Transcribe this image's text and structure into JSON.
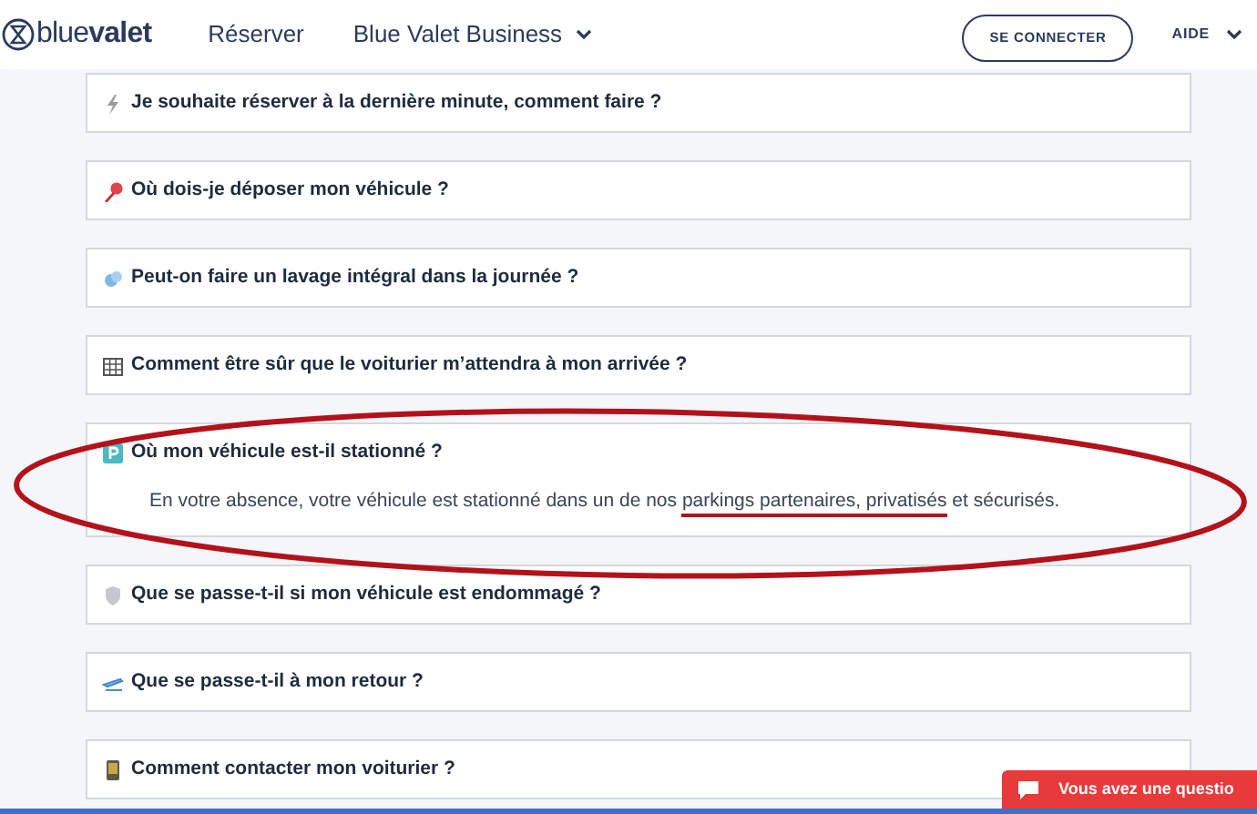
{
  "header": {
    "logo": "blue**valet**",
    "nav": [
      {
        "label": "Réserver",
        "dropdown": false
      },
      {
        "label": "Blue Valet Business",
        "dropdown": true
      }
    ],
    "login_button": "SE CONNECTER",
    "help": {
      "label": "AIDE",
      "dropdown": true
    }
  },
  "faq": [
    {
      "kind": "lightning",
      "question": "Je souhaite réserver à la dernière minute, comment faire ?",
      "expanded": false
    },
    {
      "kind": "pin",
      "question": "Où dois-je déposer mon véhicule ?",
      "expanded": false
    },
    {
      "kind": "wash",
      "question": "Peut-on faire un lavage intégral dans la journée ?",
      "expanded": false
    },
    {
      "kind": "calendar",
      "question": "Comment être sûr que le voiturier m’attendra à mon arrivée ?",
      "expanded": false
    },
    {
      "kind": "parking",
      "question": "Où mon véhicule est-il stationné ?",
      "expanded": true,
      "answer": [
        {
          "text": "En votre absence, votre véhicule est stationné dans un de nos ",
          "underlined": false
        },
        {
          "text": "parkings partenaires, privatisés",
          "underlined": true
        },
        {
          "text": " et sécurisés.",
          "underlined": false
        }
      ]
    },
    {
      "kind": "shield",
      "question": "Que se passe-t-il si mon véhicule est endommagé ?",
      "expanded": false
    },
    {
      "kind": "plane",
      "question": "Que se passe-t-il à mon retour ?",
      "expanded": false
    },
    {
      "kind": "phone",
      "question": "Comment contacter mon voiturier ?",
      "expanded": false
    }
  ],
  "annotation": {
    "kind": "ellipse"
  },
  "chat_widget": {
    "label": "Vous avez une questio"
  }
}
